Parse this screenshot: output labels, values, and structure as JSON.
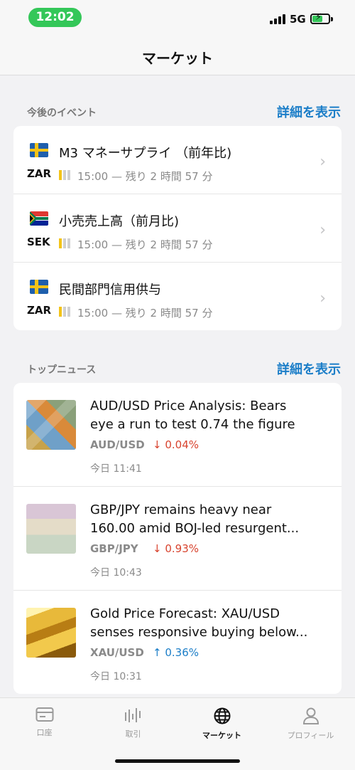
{
  "status_bar": {
    "time": "12:02",
    "network": "5G",
    "battery_charging": true
  },
  "header": {
    "title": "マーケット"
  },
  "events": {
    "section_title": "今後のイベント",
    "more_link": "詳細を表示",
    "items": [
      {
        "flag": "sweden-flag",
        "title": "M3 マネーサプライ （前年比)",
        "currency": "ZAR",
        "importance": 1,
        "meta": "15:00 — 残り 2 時間 57 分"
      },
      {
        "flag": "south-africa-flag",
        "title": "小売売上高（前月比)",
        "currency": "SEK",
        "importance": 1,
        "meta": "15:00 — 残り 2 時間 57 分"
      },
      {
        "flag": "sweden-flag",
        "title": "民間部門信用供与",
        "currency": "ZAR",
        "importance": 1,
        "meta": "15:00 — 残り 2 時間 57 分"
      }
    ]
  },
  "news": {
    "section_title": "トップニュース",
    "more_link": "詳細を表示",
    "items": [
      {
        "thumb": "aud-banknotes-image",
        "line1": "AUD/USD Price Analysis: Bears",
        "line2": "eye a run to test 0.74 the figure",
        "pair": "AUD/USD",
        "change": "↓ 0.04%",
        "direction": "down",
        "time": "今日 11:41"
      },
      {
        "thumb": "gbp-banknotes-image",
        "line1": "GBP/JPY remains heavy near",
        "line2": "160.00 amid BOJ-led resurgent...",
        "pair": "GBP/JPY",
        "change": "↓ 0.93%",
        "direction": "down",
        "time": "今日 10:43"
      },
      {
        "thumb": "gold-bars-image",
        "line1": "Gold Price Forecast: XAU/USD",
        "line2": "senses responsive buying below...",
        "pair": "XAU/USD",
        "change": "↑ 0.36%",
        "direction": "up",
        "time": "今日 10:31"
      }
    ]
  },
  "tabbar": {
    "active": "マーケット",
    "tabs": [
      {
        "icon": "account-card-icon",
        "label": "口座"
      },
      {
        "icon": "trading-chart-icon",
        "label": "取引"
      },
      {
        "icon": "globe-icon",
        "label": "マーケット"
      },
      {
        "icon": "profile-icon",
        "label": "プロフィール"
      }
    ]
  },
  "colors": {
    "accent": "#1c7ec8",
    "down": "#d8442f",
    "up": "#1c7ec8",
    "status_pill": "#34c759",
    "importance": "#f3c318"
  }
}
